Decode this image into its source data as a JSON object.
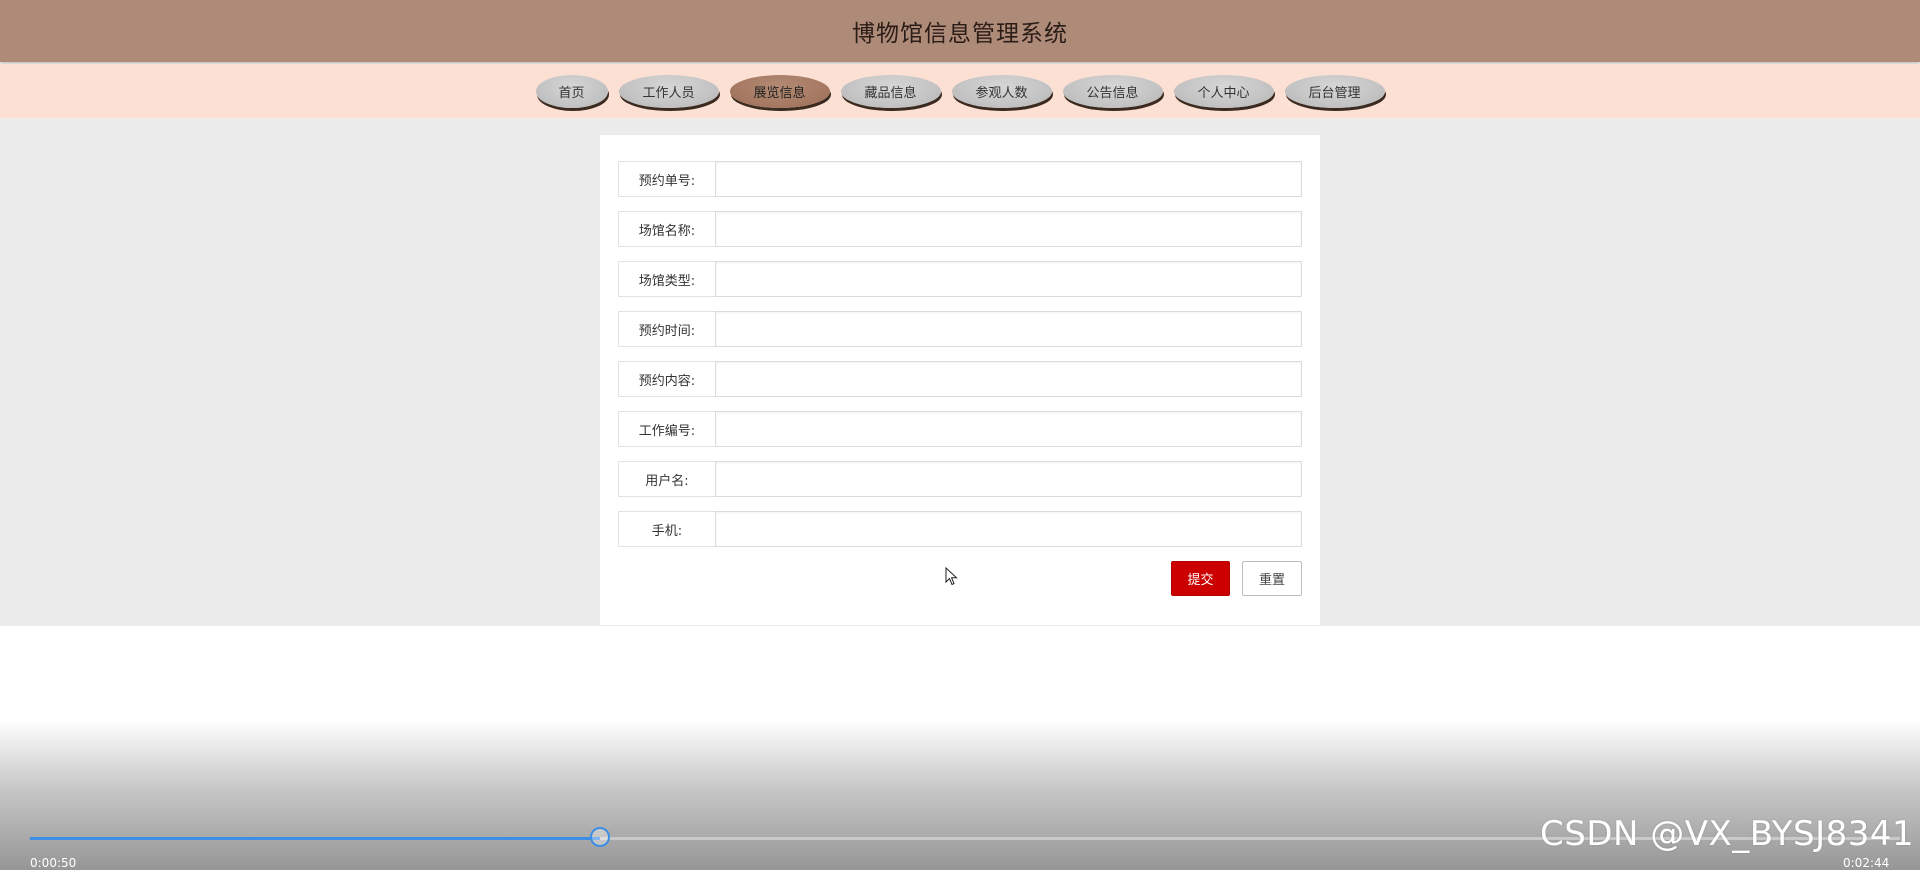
{
  "header": {
    "title": "博物馆信息管理系统"
  },
  "nav": {
    "items": [
      {
        "label": "首页",
        "active": false
      },
      {
        "label": "工作人员",
        "active": false
      },
      {
        "label": "展览信息",
        "active": true
      },
      {
        "label": "藏品信息",
        "active": false
      },
      {
        "label": "参观人数",
        "active": false
      },
      {
        "label": "公告信息",
        "active": false
      },
      {
        "label": "个人中心",
        "active": false
      },
      {
        "label": "后台管理",
        "active": false
      }
    ]
  },
  "form": {
    "fields": [
      {
        "label": "预约单号:",
        "value": ""
      },
      {
        "label": "场馆名称:",
        "value": ""
      },
      {
        "label": "场馆类型:",
        "value": ""
      },
      {
        "label": "预约时间:",
        "value": ""
      },
      {
        "label": "预约内容:",
        "value": ""
      },
      {
        "label": "工作编号:",
        "value": ""
      },
      {
        "label": "用户名:",
        "value": ""
      },
      {
        "label": "手机:",
        "value": ""
      }
    ],
    "submit_label": "提交",
    "reset_label": "重置"
  },
  "player": {
    "current_time": "0:00:50",
    "total_time": "0:02:44",
    "progress_fraction": 0.305,
    "accent_color": "#3e8ee6"
  },
  "watermark": "CSDN @VX_BYSJ8341",
  "colors": {
    "header_bg": "#ae8a78",
    "nav_bg": "#fde0d4",
    "active_tab": "#a67a63",
    "submit_bg": "#cc0000"
  }
}
